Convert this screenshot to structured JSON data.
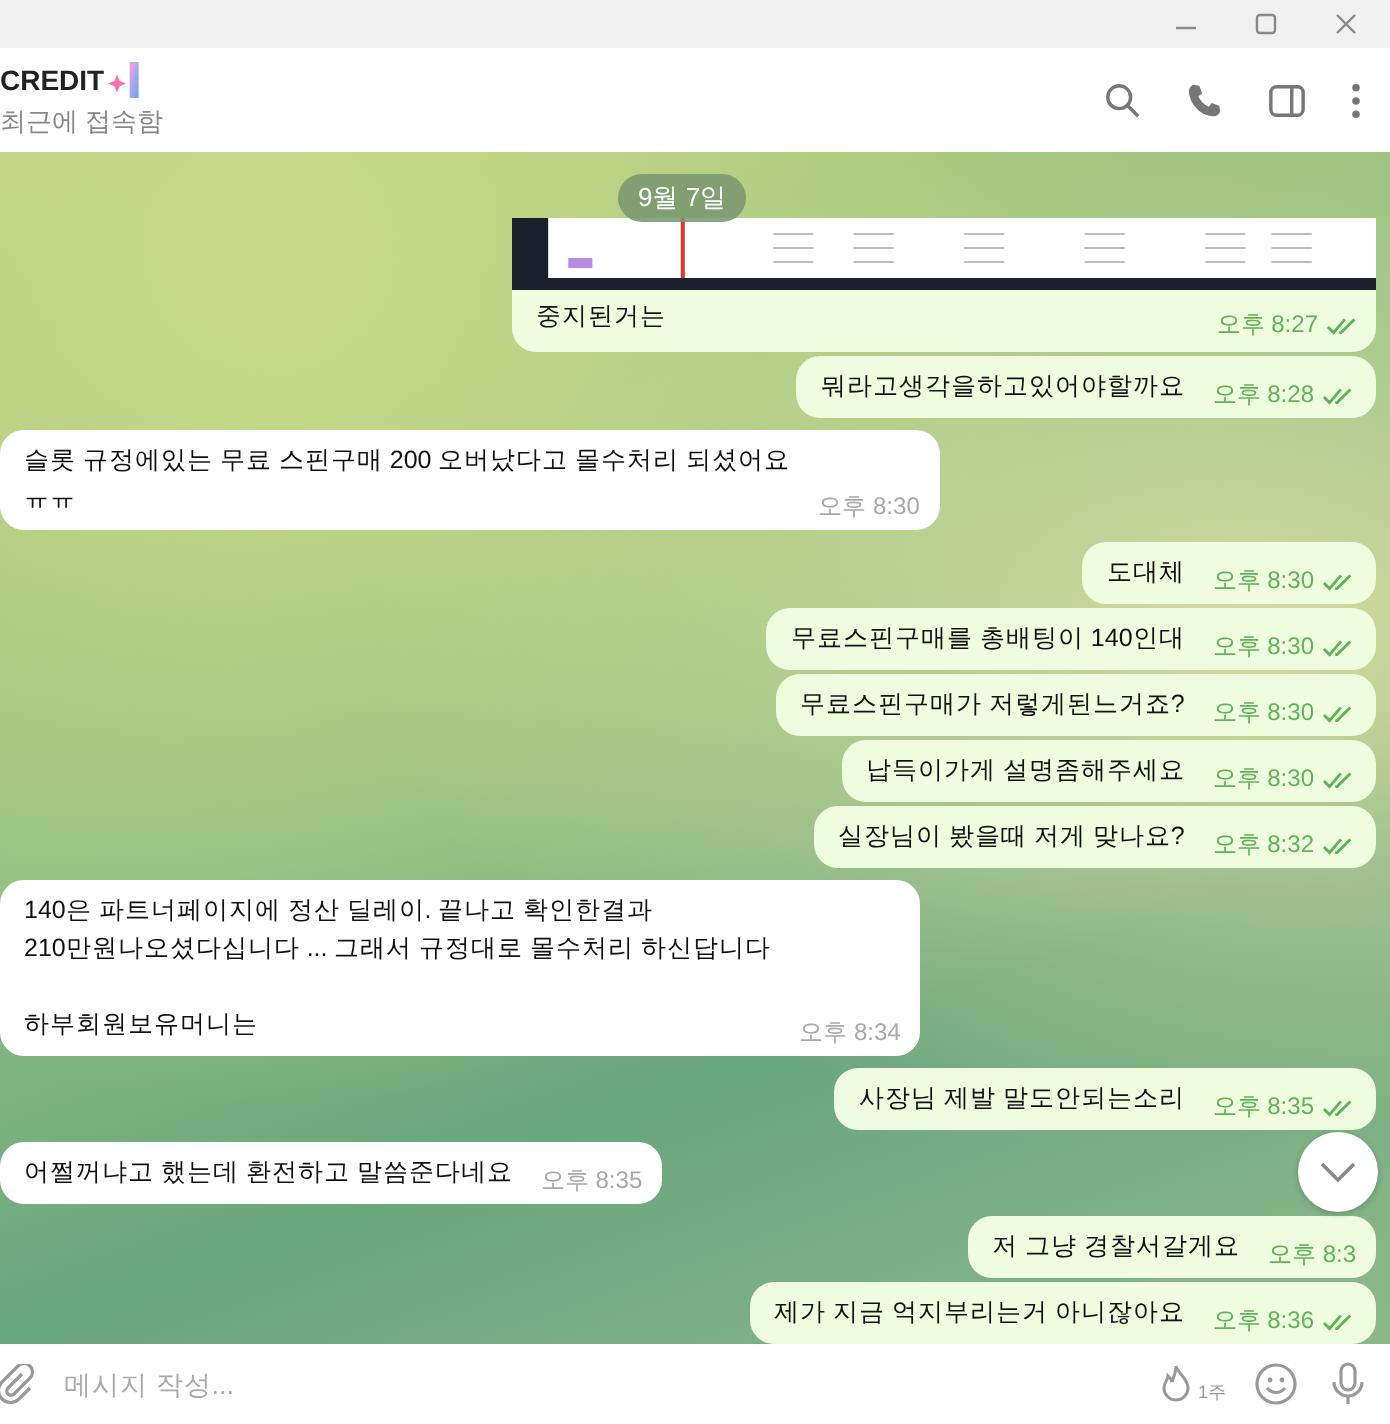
{
  "chat": {
    "name": "CREDIT",
    "status": "최근에 접속함"
  },
  "date_badge": "9월 7일",
  "messages": [
    {
      "kind": "image",
      "outgoing": true,
      "text": "중지된거는",
      "time": "오후 8:27",
      "read": true
    },
    {
      "kind": "text",
      "outgoing": true,
      "text": "뭐라고생각을하고있어야할까요",
      "time": "오후 8:28",
      "read": true
    },
    {
      "kind": "text",
      "outgoing": false,
      "text": "슬롯 규정에있는 무료 스핀구매 200 오버났다고 몰수처리 되셨어요\nㅠㅠ",
      "time": "오후 8:30"
    },
    {
      "kind": "text",
      "outgoing": true,
      "text": "도대체",
      "time": "오후 8:30",
      "read": true
    },
    {
      "kind": "text",
      "outgoing": true,
      "text": "무료스핀구매를 총배팅이 140인대",
      "time": "오후 8:30",
      "read": true
    },
    {
      "kind": "text",
      "outgoing": true,
      "text": "무료스핀구매가 저렇게된느거죠?",
      "time": "오후 8:30",
      "read": true
    },
    {
      "kind": "text",
      "outgoing": true,
      "text": "납득이가게 설명좀해주세요",
      "time": "오후 8:30",
      "read": true
    },
    {
      "kind": "text",
      "outgoing": true,
      "text": "실장님이 봤을때 저게 맞나요?",
      "time": "오후 8:32",
      "read": true
    },
    {
      "kind": "text",
      "outgoing": false,
      "text": "140은 파트너페이지에 정산 딜레이. 끝나고 확인한결과\n210만원나오셨다십니다 ... 그래서 규정대로 몰수처리 하신답니다\n\n하부회원보유머니는",
      "time": "오후 8:34"
    },
    {
      "kind": "text",
      "outgoing": true,
      "text": "사장님 제발 말도안되는소리",
      "time": "오후 8:35",
      "read": true
    },
    {
      "kind": "text",
      "outgoing": false,
      "text": "어쩔꺼냐고 했는데 환전하고 말씀준다네요",
      "time": "오후 8:35"
    },
    {
      "kind": "text",
      "outgoing": true,
      "text": "저 그냥 경찰서갈게요",
      "time": "오후 8:3"
    },
    {
      "kind": "text",
      "outgoing": true,
      "text": "제가 지금 억지부리는거 아니잖아요",
      "time": "오후 8:36",
      "read": true
    }
  ],
  "composer": {
    "placeholder": "메시지 작성...",
    "timer": "1주"
  }
}
